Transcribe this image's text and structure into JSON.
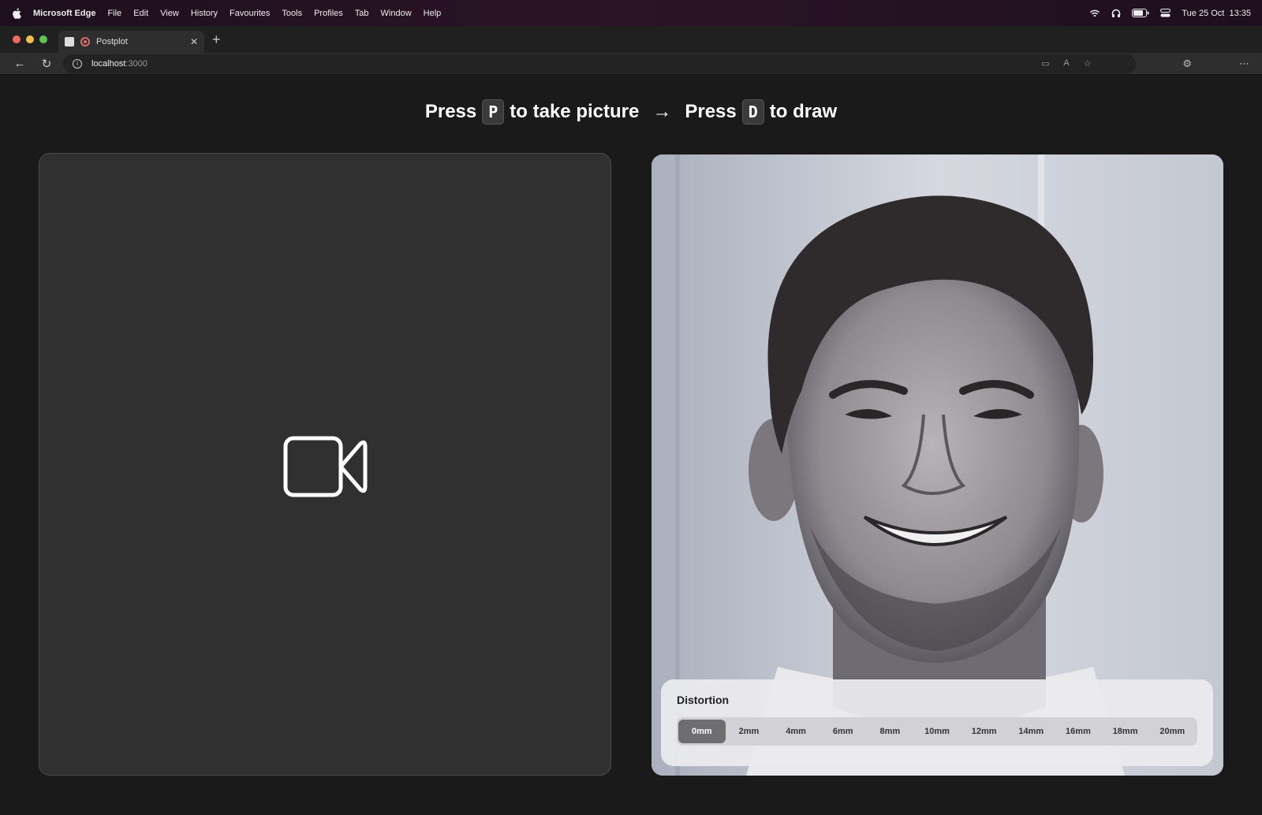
{
  "menubar": {
    "app": "Microsoft Edge",
    "items": [
      "File",
      "Edit",
      "View",
      "History",
      "Favourites",
      "Tools",
      "Profiles",
      "Tab",
      "Window",
      "Help"
    ],
    "clock": "Tue 25 Oct  13:35"
  },
  "browser": {
    "tab_title": "Postplot",
    "url_host": "localhost",
    "url_port": ":3000"
  },
  "page": {
    "headline": {
      "press1": "Press",
      "key1": "P",
      "action1": "to take picture",
      "arrow": "→",
      "press2": "Press",
      "key2": "D",
      "action2": "to draw"
    },
    "left_panel_icon": "video-camera-icon",
    "distortion": {
      "label": "Distortion",
      "options": [
        "0mm",
        "2mm",
        "4mm",
        "6mm",
        "8mm",
        "10mm",
        "12mm",
        "14mm",
        "16mm",
        "18mm",
        "20mm"
      ],
      "selected": "0mm"
    }
  },
  "colors": {
    "background": "#1a1a1a",
    "panel": "#303030",
    "segment_active": "#6e6e70"
  }
}
